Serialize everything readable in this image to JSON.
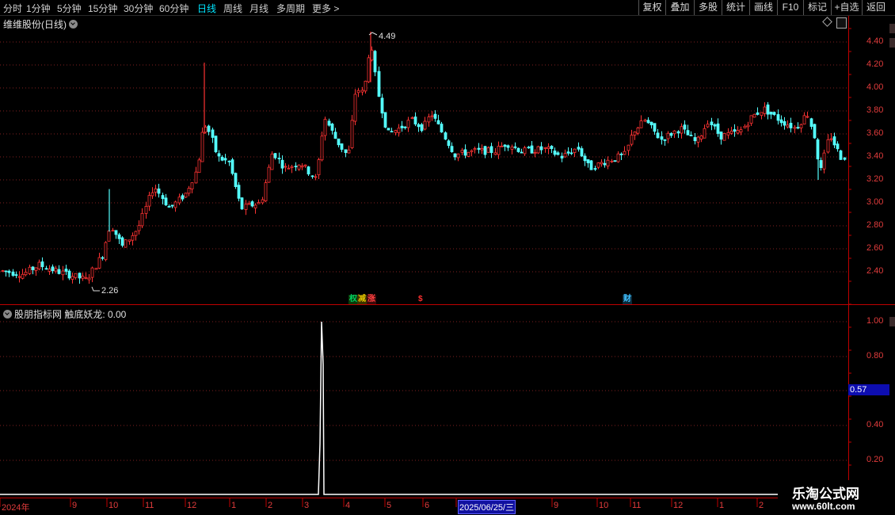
{
  "toolbar": {
    "periods": [
      "分时",
      "1分钟",
      "5分钟",
      "15分钟",
      "30分钟",
      "60分钟",
      "日线",
      "周线",
      "月线",
      "多周期",
      "更多 >"
    ],
    "active_period": "日线",
    "buttons": [
      "复权",
      "叠加",
      "多股",
      "统计",
      "画线",
      "F10",
      "标记",
      "+自选",
      "返回"
    ]
  },
  "main_panel": {
    "title": "维维股份(日线)",
    "y_ticks": [
      "4.40",
      "4.20",
      "4.00",
      "3.80",
      "3.60",
      "3.40",
      "3.20",
      "3.00",
      "2.80",
      "2.60",
      "2.40"
    ],
    "high_label": "4.49",
    "low_label": "2.26",
    "markers": [
      {
        "text": "权",
        "color": "#00d060"
      },
      {
        "text": "减",
        "color": "#e0c000"
      },
      {
        "text": "涨",
        "color": "#ff4040"
      },
      {
        "text": "$",
        "color": "#ff3030"
      },
      {
        "text": "财",
        "color": "#40c0ff"
      }
    ]
  },
  "indicator_panel": {
    "title": "股朋指标网 触底妖龙: 0.00",
    "y_ticks": [
      "1.00",
      "0.80",
      "0.40",
      "0.20"
    ],
    "current_value": "0.57"
  },
  "x_axis": {
    "labels": [
      "2024年",
      "9",
      "10",
      "11",
      "12",
      "1",
      "2",
      "3",
      "4",
      "5",
      "6",
      "2025/06/25/三",
      "9",
      "10",
      "11",
      "12",
      "1",
      "2"
    ],
    "cursor_date": "2025/06/25/三"
  },
  "watermark": {
    "line1": "乐淘公式网",
    "line2": "www.60lt.com"
  },
  "colors": {
    "up": "#ff3333",
    "down": "#54ffff",
    "axis": "#c00000",
    "grid": "#802020",
    "text_axis": "#e23c3c"
  },
  "chart_data": [
    {
      "type": "candlestick",
      "title": "维维股份(日线)",
      "ylim": [
        2.2,
        4.55
      ],
      "y_ticks": [
        2.4,
        2.6,
        2.8,
        3.0,
        3.2,
        3.4,
        3.6,
        3.8,
        4.0,
        4.2,
        4.4
      ],
      "period_labels": [
        "2024年",
        "9",
        "10",
        "11",
        "12",
        "1",
        "2",
        "3",
        "4",
        "5",
        "6",
        "9",
        "10",
        "11",
        "12",
        "1",
        "2"
      ],
      "approx_close_by_month": [
        2.42,
        2.45,
        2.62,
        3.0,
        3.25,
        3.0,
        3.25,
        3.35,
        4.0,
        3.65,
        3.45,
        3.45,
        3.4,
        3.55,
        3.65,
        3.72,
        3.45
      ],
      "annotated_high": 4.49,
      "annotated_low": 2.26
    },
    {
      "type": "line",
      "title": "股朋指标网 触底妖龙",
      "ylim": [
        0,
        1.05
      ],
      "y_ticks": [
        0.2,
        0.4,
        0.8,
        1.0
      ],
      "value_now": 0.0,
      "spike": {
        "at": "3-4",
        "value": 1.0
      }
    }
  ]
}
